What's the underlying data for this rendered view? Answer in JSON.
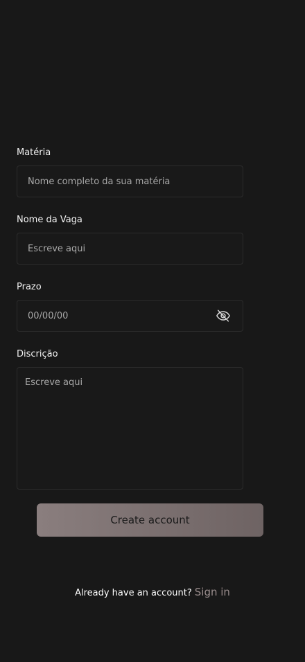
{
  "form": {
    "materia": {
      "label": "Matéria",
      "placeholder": "Nome completo da sua matéria"
    },
    "vaga": {
      "label": "Nome da Vaga",
      "placeholder": "Escreve aqui"
    },
    "prazo": {
      "label": "Prazo",
      "placeholder": "00/00/00",
      "icon": "eye-off-icon"
    },
    "descricao": {
      "label": "Discrição",
      "placeholder": "Escreve aqui"
    }
  },
  "actions": {
    "create_label": "Create account"
  },
  "footer": {
    "prompt": "Already have an account?",
    "link": "Sign in"
  },
  "colors": {
    "background": "#181818",
    "button": "#7d7272",
    "link": "#9a8d8d"
  }
}
